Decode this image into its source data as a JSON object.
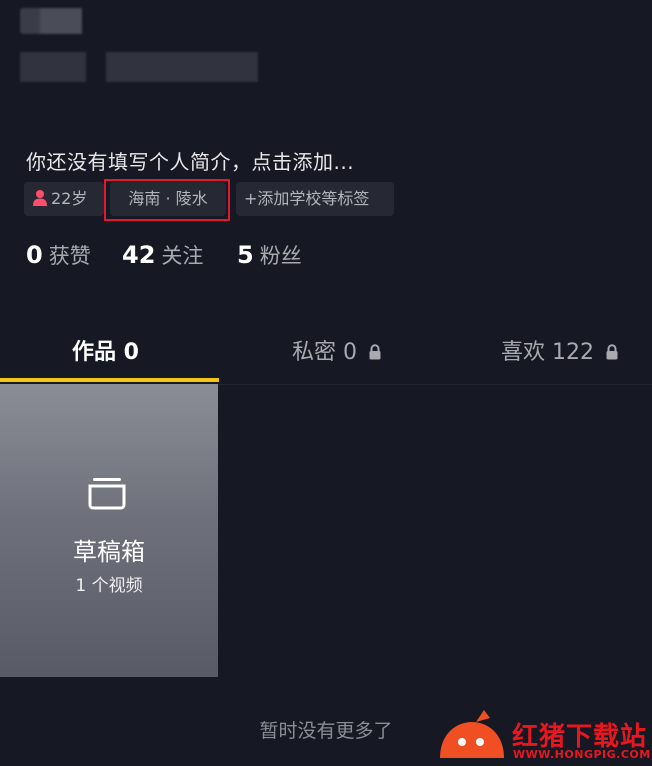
{
  "profile": {
    "bio": "你还没有填写个人简介，点击添加...",
    "tags": {
      "age": "22岁",
      "location": "海南 · 陵水",
      "add_tag": "+添加学校等标签"
    },
    "stats": [
      {
        "value": "0",
        "label": "获赞"
      },
      {
        "value": "42",
        "label": "关注"
      },
      {
        "value": "5",
        "label": "粉丝"
      }
    ]
  },
  "tabs": [
    {
      "label": "作品 0",
      "active": true
    },
    {
      "label": "私密 0",
      "locked": true
    },
    {
      "label": "喜欢 122",
      "locked": true
    }
  ],
  "draft": {
    "icon": "drafts-box-icon",
    "title": "草稿箱",
    "count": "1 个视频"
  },
  "footer": {
    "no_more": "暂时没有更多了"
  },
  "watermark": {
    "brand": "红猪下载站",
    "url": "WWW.HONGPIG.COM"
  },
  "colors": {
    "background": "#161823",
    "tab_indicator": "#f5c518",
    "highlight_box": "#e0192c",
    "age_icon": "#ff4d6d"
  }
}
